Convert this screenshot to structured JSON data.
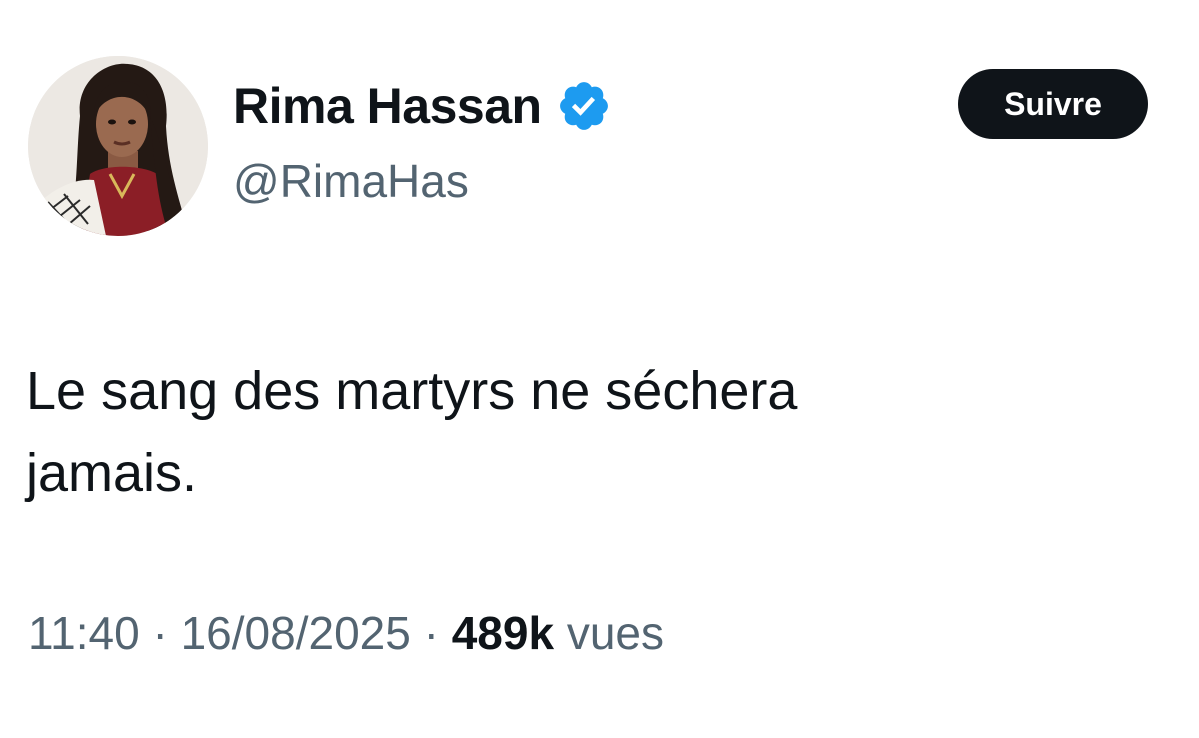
{
  "profile": {
    "display_name": "Rima Hassan",
    "handle": "@RimaHas",
    "verified_icon": "verified-badge-icon",
    "verified_color": "#1d9bf0"
  },
  "follow_button": {
    "label": "Suivre",
    "background": "#0f1419",
    "text_color": "#ffffff"
  },
  "tweet": {
    "text": "Le sang des martyrs ne séchera\njamais."
  },
  "meta": {
    "time": "11:40",
    "separator": "·",
    "date": "16/08/2025",
    "views_count": "489k",
    "views_label": "vues"
  },
  "colors": {
    "text_primary": "#0f1419",
    "text_secondary": "#536471",
    "background": "#ffffff"
  }
}
